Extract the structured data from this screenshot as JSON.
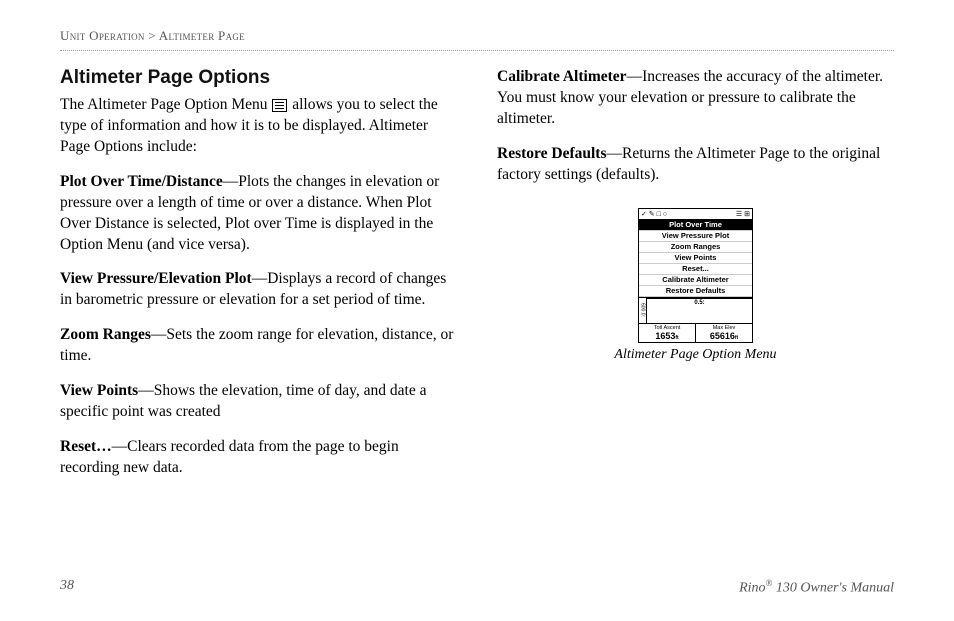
{
  "header": {
    "section": "Unit Operation",
    "separator": " > ",
    "page": "Altimeter Page"
  },
  "leftColumn": {
    "heading": "Altimeter Page Options",
    "introBefore": "The Altimeter Page Option Menu ",
    "introAfter": " allows you to select the type of information and how it is to be displayed. Altimeter Page Options include:",
    "options": [
      {
        "name": "Plot Over Time/Distance",
        "desc": "—Plots the changes in elevation or pressure over a length of time or over a distance. When Plot Over Distance is selected, Plot over Time is displayed in the Option Menu (and vice versa)."
      },
      {
        "name": "View Pressure/Elevation Plot",
        "desc": "—Displays a record of changes in barometric pressure or elevation for a set period of time."
      },
      {
        "name": "Zoom Ranges",
        "desc": "—Sets the zoom range for elevation, distance, or time."
      },
      {
        "name": "View Points",
        "desc": "—Shows the elevation, time of day, and date a specific point was created"
      },
      {
        "name": "Reset…",
        "desc": "—Clears recorded data from the page to begin recording new data."
      }
    ]
  },
  "rightColumn": {
    "options": [
      {
        "name": "Calibrate Altimeter",
        "desc": "—Increases the accuracy of the altimeter. You must know your elevation or pressure to calibrate the altimeter."
      },
      {
        "name": "Restore Defaults",
        "desc": "—Returns the Altimeter Page to the original factory settings (defaults)."
      }
    ],
    "screenshot": {
      "menuItems": [
        "Plot Over Time",
        "View Pressure Plot",
        "Zoom Ranges",
        "View Points",
        "Reset...",
        "Calibrate Altimeter",
        "Restore Defaults"
      ],
      "highlightedIndex": 0,
      "yAxisRange": "600.0:",
      "xRange": "0.5:",
      "footerLeftLabel": "Totl Ascent",
      "footerLeftValue": "1653",
      "footerLeftUnit": "ft",
      "footerRightLabel": "Max Elev",
      "footerRightValue": "65616",
      "footerRightUnit": "ft",
      "topbarLeft": "✓ ✎ □ ○",
      "topbarRight": "☰ ⊞"
    },
    "caption": "Altimeter Page Option Menu"
  },
  "footer": {
    "pageNumber": "38",
    "brand": "Rino",
    "reg": "®",
    "model": " 130 Owner's Manual"
  }
}
